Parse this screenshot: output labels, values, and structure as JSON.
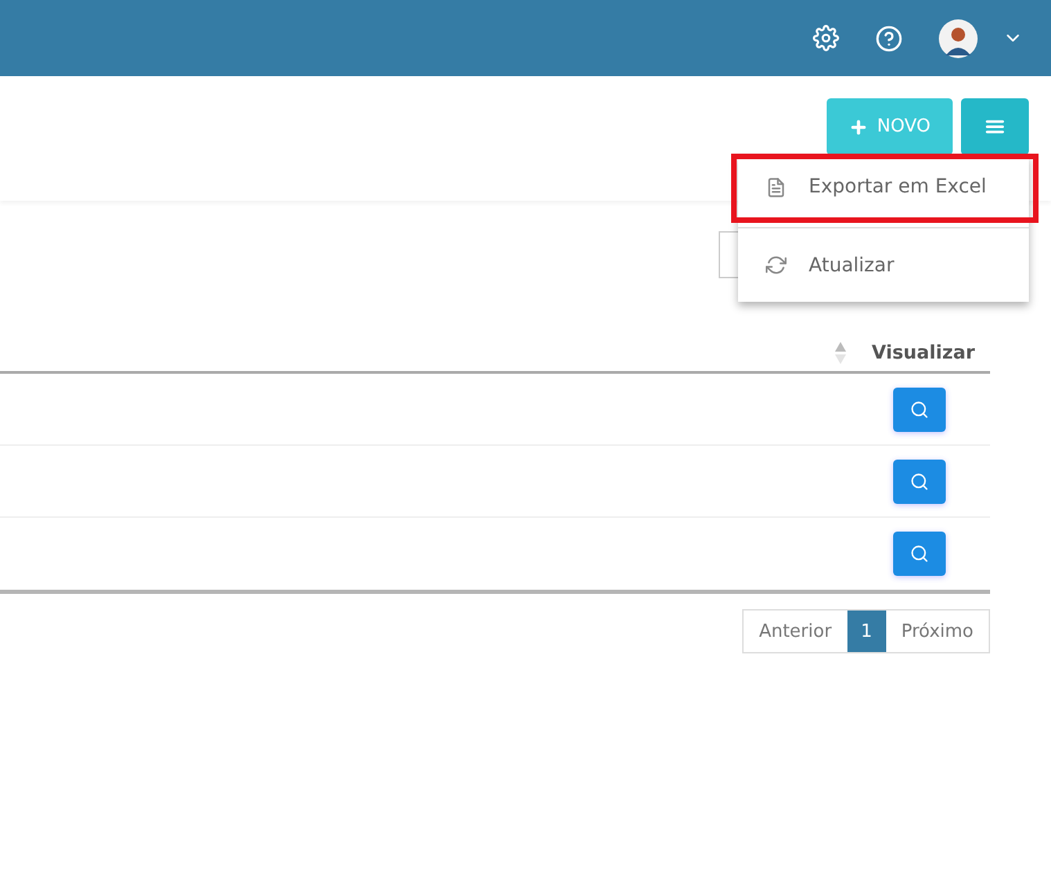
{
  "header": {
    "icons": [
      {
        "kind": "settings"
      },
      {
        "kind": "help"
      },
      {
        "kind": "avatar"
      },
      {
        "kind": "caret"
      }
    ]
  },
  "toolbar": {
    "new_button": "NOVO",
    "menu_open": true
  },
  "menu": {
    "items": [
      {
        "kind": "excel",
        "label": "Exportar em Excel",
        "highlighted": true
      },
      {
        "kind": "refresh",
        "label": "Atualizar",
        "highlighted": false
      }
    ]
  },
  "table": {
    "columns": [
      {
        "kind": "sort"
      },
      {
        "kind": "label",
        "label": "Visualizar"
      }
    ],
    "rows": [
      {
        "kind": "view"
      },
      {
        "kind": "view"
      },
      {
        "kind": "view"
      }
    ]
  },
  "pagination": {
    "previous": "Anterior",
    "pages": [
      {
        "label": "1",
        "selected": true
      }
    ],
    "next": "Próximo"
  }
}
